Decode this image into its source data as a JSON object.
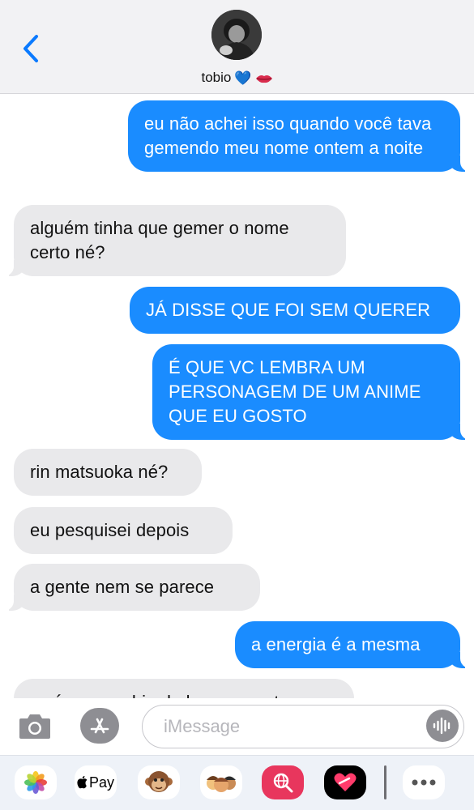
{
  "header": {
    "contact_name": "tobio",
    "contact_emoji_heart": "💙",
    "contact_emoji_lips": "lips-icon"
  },
  "messages": [
    {
      "from": "me",
      "text": "eu não achei isso quando você tava gemendo meu nome ontem a noite"
    },
    {
      "from": "them",
      "text": "alguém tinha que gemer o nome certo né?"
    },
    {
      "from": "me",
      "text": "JÁ DISSE QUE FOI SEM QUERER"
    },
    {
      "from": "me",
      "text": "É QUE VC LEMBRA UM PERSONAGEM DE UM ANIME QUE EU GOSTO"
    },
    {
      "from": "them",
      "text": "rin matsuoka né?"
    },
    {
      "from": "them",
      "text": "eu pesquisei depois"
    },
    {
      "from": "them",
      "text": "a gente nem se parece"
    },
    {
      "from": "me",
      "text": "a energia é a mesma"
    },
    {
      "from": "them",
      "text": "vc é companhia de luz pra gostar"
    }
  ],
  "input": {
    "placeholder": "iMessage"
  },
  "drawer": {
    "apple_pay_label": "Pay"
  },
  "colors": {
    "outgoing_bubble": "#1a8cff",
    "incoming_bubble": "#e9e9eb",
    "accent": "#0a7aff"
  }
}
